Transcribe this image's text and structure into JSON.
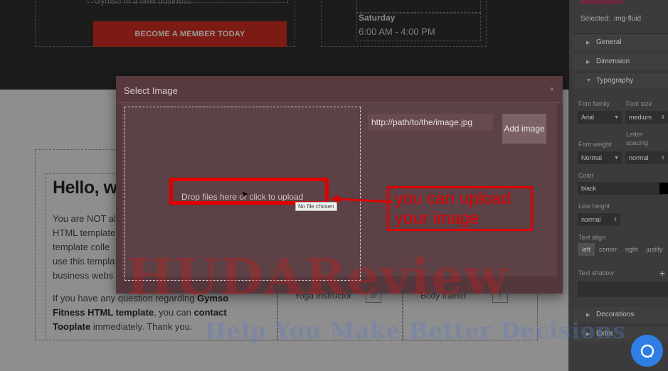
{
  "site": {
    "top_cut_text": "Gymso to a new business.",
    "member_button": "BECOME A MEMBER TODAY",
    "schedule_day": "Saturday",
    "schedule_hours": "6:00 AM - 4:00 PM",
    "hello_heading": "Hello, w",
    "para1_lines": [
      "You are NOT al",
      "HTML template",
      "template colle",
      "use this templa",
      "business webs"
    ],
    "para2_part1": "If you have any question regarding ",
    "para2_bold1": "Gymso",
    "para2_bold2": "Fitness HTML template",
    "para2_part2": ", you can ",
    "para2_bold3": "contact",
    "para2_bold4": "Tooplate",
    "para2_part3": " immediately. Thank you.",
    "yoga_label": "Yoga Instructor",
    "body_label": "Body trainer"
  },
  "panel": {
    "selected_text": "Selected: .img-fluid",
    "sections": {
      "general": "General",
      "dimension": "Dimension",
      "typography": "Typography",
      "decorations": "Decorations",
      "extra": "Extra"
    },
    "font_family_label": "Font family",
    "font_family_value": "Arial",
    "font_size_label": "Font size",
    "font_size_value": "medium",
    "font_weight_label": "Font weight",
    "font_weight_value": "Normal",
    "letter_spacing_label": "Letter spacing",
    "letter_spacing_value": "normal",
    "color_label": "Color",
    "color_value": "black",
    "line_height_label": "Line height",
    "line_height_value": "normal",
    "text_align_label": "Text align",
    "align_options": [
      "left",
      "center",
      "right",
      "justify"
    ],
    "text_shadow_label": "Text shadow"
  },
  "modal": {
    "title": "Select Image",
    "close": "×",
    "drop_text": "Drop files here or click to upload",
    "file_tooltip": "No file chosen",
    "url_value": "http://path/to/the/image.jpg",
    "add_button": "Add image"
  },
  "annotation": {
    "text": "you can upload\nyour image",
    "color": "#e00000"
  },
  "watermark": {
    "big": "HUDAReview",
    "small": "Help You Make Better Decisions"
  },
  "colors": {
    "accent_red": "#c8180a",
    "help_blue": "#2f7ee6"
  }
}
